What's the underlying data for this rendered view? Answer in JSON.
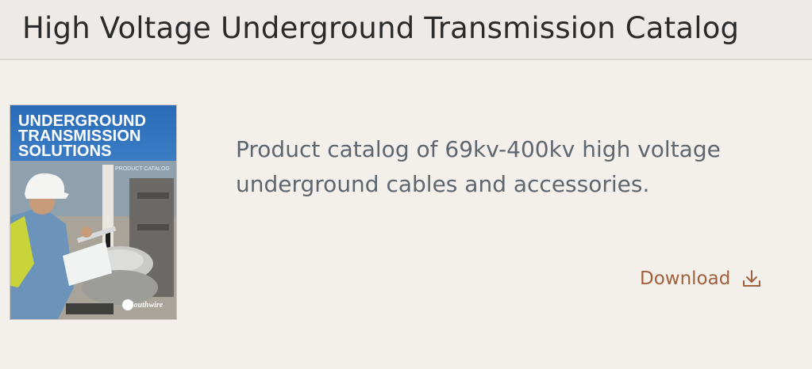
{
  "card": {
    "title": "High Voltage Underground Transmission Catalog",
    "description": "Product catalog of 69kv-400kv high voltage underground cables and accessories.",
    "download_label": "Download",
    "download_icon": "download-icon"
  },
  "cover": {
    "title_lines": [
      "UNDERGROUND",
      "TRANSMISSION",
      "SOLUTIONS"
    ],
    "subtitle": "PRODUCT CATALOG",
    "brand": "Southwire"
  },
  "colors": {
    "accent": "#a0603c",
    "header_bg": "#edeae7",
    "body_bg": "#f3efeb",
    "cover_blue": "#2a6bb8"
  }
}
